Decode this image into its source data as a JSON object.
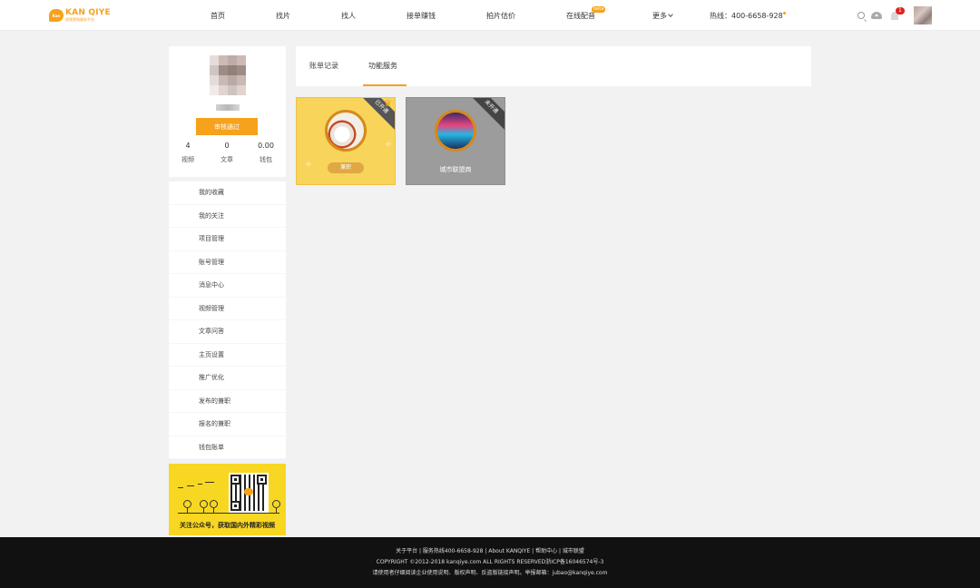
{
  "brand": {
    "name": "KAN QIYE",
    "subtitle": "视频营销服务平台",
    "badge": "Kan"
  },
  "nav": {
    "items": [
      "首页",
      "找片",
      "找人",
      "接单赚钱",
      "拍片估价",
      "在线配音",
      "更多"
    ],
    "beta": "beta",
    "hotline": "热线：400-6658-928",
    "notifications": "1"
  },
  "colors": {
    "accent": "#f6a21c",
    "footer_bg": "#111111"
  },
  "profile": {
    "verify_label": "审核通过",
    "stats": [
      {
        "value": "4",
        "label": "视频"
      },
      {
        "value": "0",
        "label": "文章"
      },
      {
        "value": "0.00",
        "label": "钱包"
      }
    ]
  },
  "menu": [
    "我的收藏",
    "我的关注",
    "项目管理",
    "账号管理",
    "消息中心",
    "视频管理",
    "文章问答",
    "主页设置",
    "推广优化",
    "发布的兼职",
    "报名的兼职",
    "钱包账单"
  ],
  "promo": {
    "qr_badge": "Kan",
    "text": "关注公众号，获取国内外精彩视频"
  },
  "tabs": [
    "账单记录",
    "功能服务"
  ],
  "services": [
    {
      "ribbon": "已开通",
      "label": "兼职"
    },
    {
      "ribbon": "未开通",
      "label": "城市联盟商"
    }
  ],
  "footer": {
    "line1": "关于平台 | 服务热线400-6658-928 | About KANQIYE | 帮助中心 | 城市联盟",
    "line2": "COPYRIGHT ©2012-2018 kanqiye.com ALL RIGHTS RESERVED浙ICP备16046574号-3",
    "line3": "请使用者仔细阅读企业使用说明、版权声明、反盗版链接声明。举报邮箱：jubao@kanqiye.com"
  }
}
